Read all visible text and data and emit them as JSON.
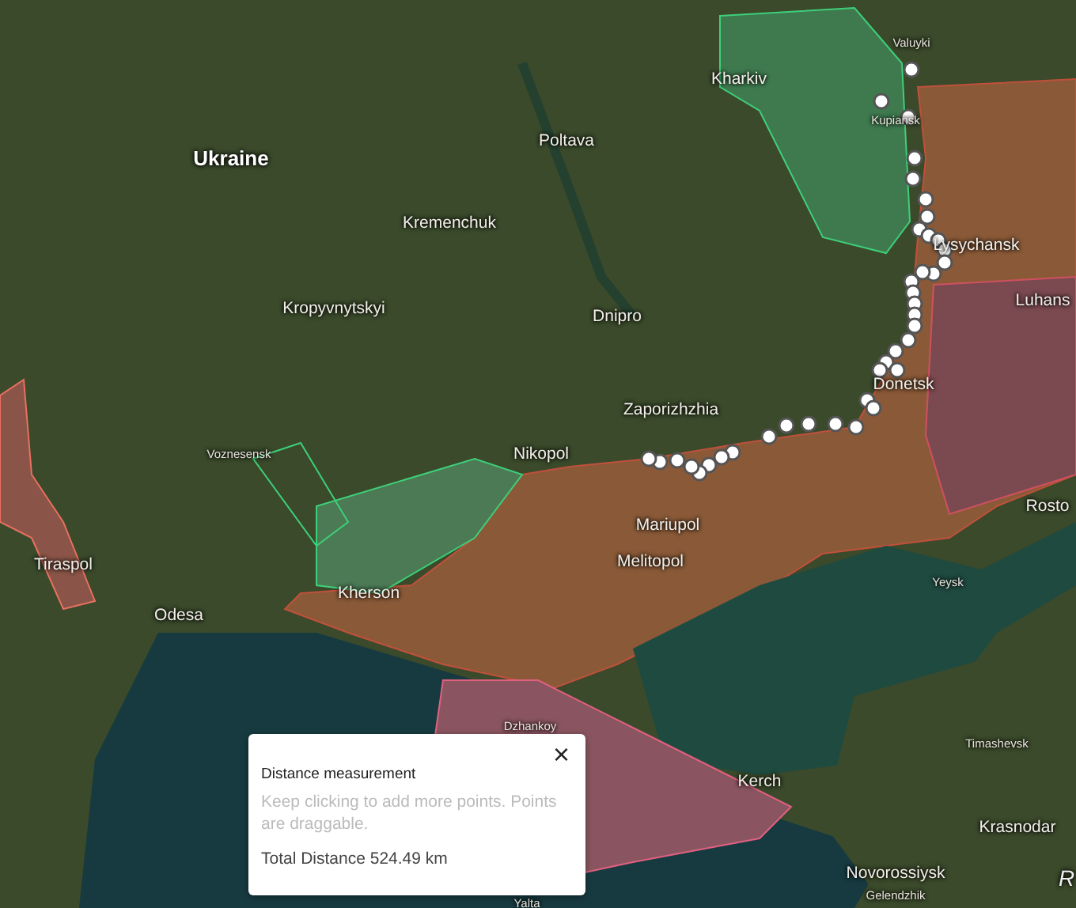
{
  "map": {
    "labels": [
      {
        "text": "Ukraine",
        "kind": "country"
      },
      {
        "text": "Kharkiv",
        "kind": "city"
      },
      {
        "text": "Valuyki",
        "kind": "town"
      },
      {
        "text": "Kupiansk",
        "kind": "town"
      },
      {
        "text": "Poltava",
        "kind": "city"
      },
      {
        "text": "Kremenchuk",
        "kind": "city"
      },
      {
        "text": "Lysychansk",
        "kind": "city"
      },
      {
        "text": "Luhans",
        "kind": "city"
      },
      {
        "text": "Kropyvnytskyi",
        "kind": "city"
      },
      {
        "text": "Dnipro",
        "kind": "city"
      },
      {
        "text": "Donetsk",
        "kind": "city"
      },
      {
        "text": "Zaporizhzhia",
        "kind": "city"
      },
      {
        "text": "Rosto",
        "kind": "city"
      },
      {
        "text": "Voznesensk",
        "kind": "town"
      },
      {
        "text": "Nikopol",
        "kind": "city"
      },
      {
        "text": "Tiraspol",
        "kind": "city"
      },
      {
        "text": "Mariupol",
        "kind": "city"
      },
      {
        "text": "Melitopol",
        "kind": "city"
      },
      {
        "text": "Yeysk",
        "kind": "town"
      },
      {
        "text": "Kherson",
        "kind": "city"
      },
      {
        "text": "Odesa",
        "kind": "city"
      },
      {
        "text": "Dzhankoy",
        "kind": "town"
      },
      {
        "text": "Timashevsk",
        "kind": "town"
      },
      {
        "text": "Kerch",
        "kind": "city"
      },
      {
        "text": "Krasnodar",
        "kind": "city"
      },
      {
        "text": "Novorossiysk",
        "kind": "city"
      },
      {
        "text": "Gelendzhik",
        "kind": "town"
      },
      {
        "text": "Yalta",
        "kind": "town"
      },
      {
        "text": "R",
        "kind": "region"
      }
    ]
  },
  "popup": {
    "title": "Distance measurement",
    "hint": "Keep clicking to add more points. Points are draggable.",
    "total": "Total Distance 524.49 km",
    "close": "×"
  }
}
